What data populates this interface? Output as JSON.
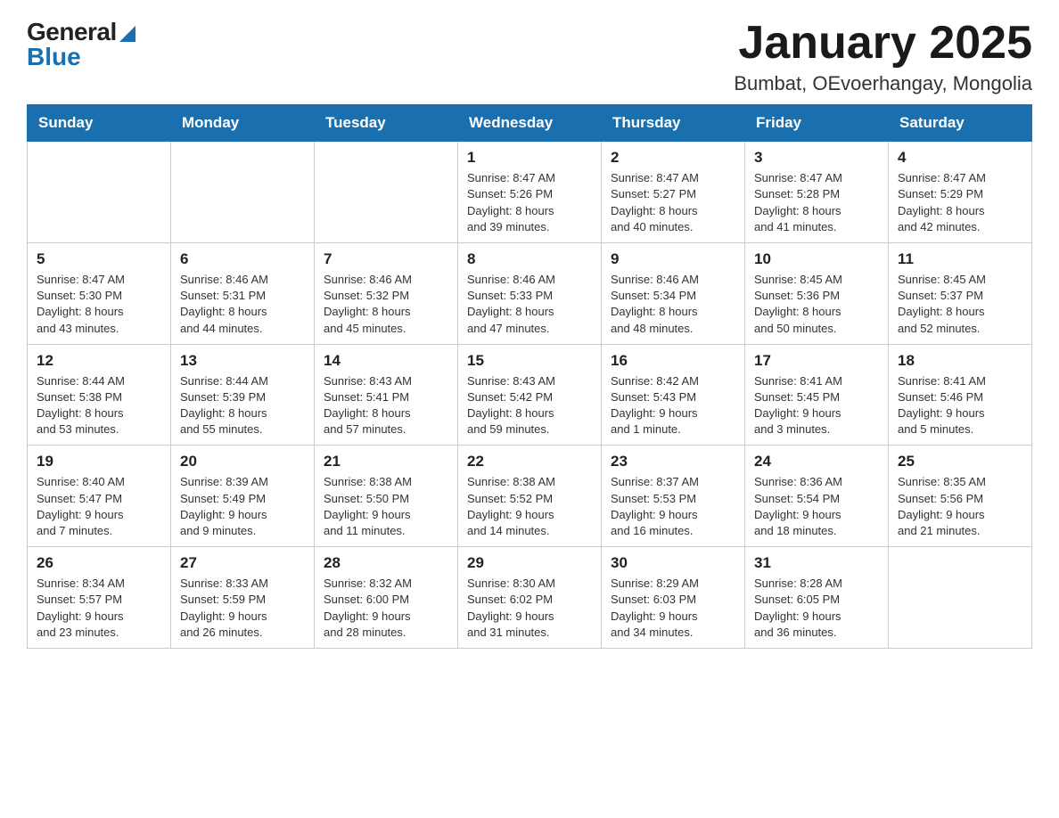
{
  "header": {
    "logo_general": "General",
    "logo_blue": "Blue",
    "month_title": "January 2025",
    "location": "Bumbat, OEvoerhangay, Mongolia"
  },
  "weekdays": [
    "Sunday",
    "Monday",
    "Tuesday",
    "Wednesday",
    "Thursday",
    "Friday",
    "Saturday"
  ],
  "weeks": [
    [
      {
        "day": "",
        "info": ""
      },
      {
        "day": "",
        "info": ""
      },
      {
        "day": "",
        "info": ""
      },
      {
        "day": "1",
        "info": "Sunrise: 8:47 AM\nSunset: 5:26 PM\nDaylight: 8 hours\nand 39 minutes."
      },
      {
        "day": "2",
        "info": "Sunrise: 8:47 AM\nSunset: 5:27 PM\nDaylight: 8 hours\nand 40 minutes."
      },
      {
        "day": "3",
        "info": "Sunrise: 8:47 AM\nSunset: 5:28 PM\nDaylight: 8 hours\nand 41 minutes."
      },
      {
        "day": "4",
        "info": "Sunrise: 8:47 AM\nSunset: 5:29 PM\nDaylight: 8 hours\nand 42 minutes."
      }
    ],
    [
      {
        "day": "5",
        "info": "Sunrise: 8:47 AM\nSunset: 5:30 PM\nDaylight: 8 hours\nand 43 minutes."
      },
      {
        "day": "6",
        "info": "Sunrise: 8:46 AM\nSunset: 5:31 PM\nDaylight: 8 hours\nand 44 minutes."
      },
      {
        "day": "7",
        "info": "Sunrise: 8:46 AM\nSunset: 5:32 PM\nDaylight: 8 hours\nand 45 minutes."
      },
      {
        "day": "8",
        "info": "Sunrise: 8:46 AM\nSunset: 5:33 PM\nDaylight: 8 hours\nand 47 minutes."
      },
      {
        "day": "9",
        "info": "Sunrise: 8:46 AM\nSunset: 5:34 PM\nDaylight: 8 hours\nand 48 minutes."
      },
      {
        "day": "10",
        "info": "Sunrise: 8:45 AM\nSunset: 5:36 PM\nDaylight: 8 hours\nand 50 minutes."
      },
      {
        "day": "11",
        "info": "Sunrise: 8:45 AM\nSunset: 5:37 PM\nDaylight: 8 hours\nand 52 minutes."
      }
    ],
    [
      {
        "day": "12",
        "info": "Sunrise: 8:44 AM\nSunset: 5:38 PM\nDaylight: 8 hours\nand 53 minutes."
      },
      {
        "day": "13",
        "info": "Sunrise: 8:44 AM\nSunset: 5:39 PM\nDaylight: 8 hours\nand 55 minutes."
      },
      {
        "day": "14",
        "info": "Sunrise: 8:43 AM\nSunset: 5:41 PM\nDaylight: 8 hours\nand 57 minutes."
      },
      {
        "day": "15",
        "info": "Sunrise: 8:43 AM\nSunset: 5:42 PM\nDaylight: 8 hours\nand 59 minutes."
      },
      {
        "day": "16",
        "info": "Sunrise: 8:42 AM\nSunset: 5:43 PM\nDaylight: 9 hours\nand 1 minute."
      },
      {
        "day": "17",
        "info": "Sunrise: 8:41 AM\nSunset: 5:45 PM\nDaylight: 9 hours\nand 3 minutes."
      },
      {
        "day": "18",
        "info": "Sunrise: 8:41 AM\nSunset: 5:46 PM\nDaylight: 9 hours\nand 5 minutes."
      }
    ],
    [
      {
        "day": "19",
        "info": "Sunrise: 8:40 AM\nSunset: 5:47 PM\nDaylight: 9 hours\nand 7 minutes."
      },
      {
        "day": "20",
        "info": "Sunrise: 8:39 AM\nSunset: 5:49 PM\nDaylight: 9 hours\nand 9 minutes."
      },
      {
        "day": "21",
        "info": "Sunrise: 8:38 AM\nSunset: 5:50 PM\nDaylight: 9 hours\nand 11 minutes."
      },
      {
        "day": "22",
        "info": "Sunrise: 8:38 AM\nSunset: 5:52 PM\nDaylight: 9 hours\nand 14 minutes."
      },
      {
        "day": "23",
        "info": "Sunrise: 8:37 AM\nSunset: 5:53 PM\nDaylight: 9 hours\nand 16 minutes."
      },
      {
        "day": "24",
        "info": "Sunrise: 8:36 AM\nSunset: 5:54 PM\nDaylight: 9 hours\nand 18 minutes."
      },
      {
        "day": "25",
        "info": "Sunrise: 8:35 AM\nSunset: 5:56 PM\nDaylight: 9 hours\nand 21 minutes."
      }
    ],
    [
      {
        "day": "26",
        "info": "Sunrise: 8:34 AM\nSunset: 5:57 PM\nDaylight: 9 hours\nand 23 minutes."
      },
      {
        "day": "27",
        "info": "Sunrise: 8:33 AM\nSunset: 5:59 PM\nDaylight: 9 hours\nand 26 minutes."
      },
      {
        "day": "28",
        "info": "Sunrise: 8:32 AM\nSunset: 6:00 PM\nDaylight: 9 hours\nand 28 minutes."
      },
      {
        "day": "29",
        "info": "Sunrise: 8:30 AM\nSunset: 6:02 PM\nDaylight: 9 hours\nand 31 minutes."
      },
      {
        "day": "30",
        "info": "Sunrise: 8:29 AM\nSunset: 6:03 PM\nDaylight: 9 hours\nand 34 minutes."
      },
      {
        "day": "31",
        "info": "Sunrise: 8:28 AM\nSunset: 6:05 PM\nDaylight: 9 hours\nand 36 minutes."
      },
      {
        "day": "",
        "info": ""
      }
    ]
  ]
}
